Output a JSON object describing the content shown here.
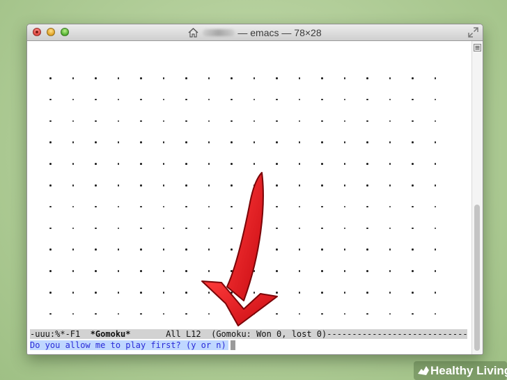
{
  "window": {
    "title": "— emacs — 78×28",
    "username_obscured": true
  },
  "colors": {
    "background": "#aecb95",
    "modeline_bg": "#d2d2d2",
    "prompt_fg": "#2a2ad8",
    "prompt_bg": "#bfd7ff",
    "arrow": "#e8141b"
  },
  "board": {
    "rows": 12,
    "cols": 18,
    "empty_symbol": "."
  },
  "modeline": {
    "flags": "-uuu:%*-F1  ",
    "buffer_name": "*Gomoku*",
    "position": "       All L12  ",
    "mode": "(Gomoku: Won 0, lost 0)-----------------------------"
  },
  "minibuffer": {
    "prompt": "Do you allow me to play first? (y or n)"
  },
  "watermark": {
    "text": "Healthy Living"
  },
  "icons": {
    "home": "home-icon",
    "fullscreen": "fullscreen-icon",
    "scroll_menu": "scroll-menu-icon",
    "annotation": "red-arrow-icon"
  }
}
